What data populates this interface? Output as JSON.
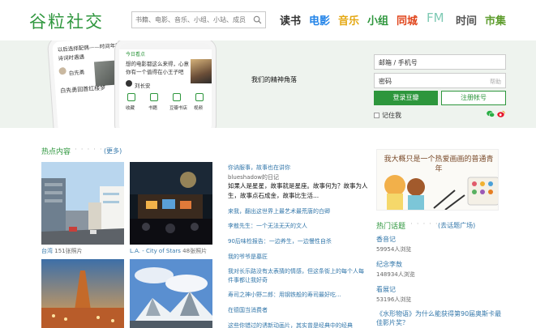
{
  "logo": "谷粒社交",
  "search": {
    "placeholder": "书籍、电影、音乐、小组、小站、成员"
  },
  "nav": [
    {
      "label": "读书",
      "color": "#333333"
    },
    {
      "label": "电影",
      "color": "#2384e8"
    },
    {
      "label": "音乐",
      "color": "#e4a813"
    },
    {
      "label": "小组",
      "color": "#2e963d"
    },
    {
      "label": "同城",
      "color": "#e0451c"
    },
    {
      "label": "FM",
      "color": "#7ecab4"
    },
    {
      "label": "时间",
      "color": "#555555"
    },
    {
      "label": "市集",
      "color": "#5e9d2e"
    }
  ],
  "hero": {
    "slogan": "我们的精神角落",
    "phone1": {
      "line1": "以后选择配偶——时间年轻",
      "line2": "诗词时遇遇",
      "author": "白先勇",
      "title": "白先勇回首红楼梦"
    },
    "phone2": {
      "tag": "今日看点",
      "line1": "想的电影都这么来得，心意",
      "line2": "你有一个值得在小王子吧",
      "author": "刘长安",
      "menu": [
        "收藏",
        "书籍",
        "豆瓣书店",
        "视频"
      ]
    }
  },
  "login": {
    "email_placeholder": "邮箱 / 手机号",
    "password_placeholder": "密码",
    "forgot": "帮助",
    "login_button": "登录豆瓣",
    "register_button": "注册帐号",
    "remember": "记住我"
  },
  "hot": {
    "title": "热点内容",
    "dots": "· · · · · ·",
    "more": "(更多)",
    "photos": [
      {
        "name": "台湾",
        "count": "151张照片"
      },
      {
        "name": "L.A. - City of Stars",
        "count": "48张照片"
      },
      {
        "name": "",
        "count": ""
      },
      {
        "name": "",
        "count": ""
      }
    ]
  },
  "articles": {
    "featured_title": "你讷服事，故事也在讲你",
    "featured_author": "blueshadow的日记",
    "featured_desc": "如果人是星星，故事就是星座。故事何为？故事为人生，故事点石成金，故事比生活...",
    "items": [
      "来我，翻出这世界上最艺术最荒唐的白卿",
      "李敖先生：一个无法无天的文人",
      "90后味检报告：一边养生，一边慢性自杀",
      "我的爷爷是墓匠",
      "我对长乐路没有太表猜的情感，但这条街上的每个人每件事都让我好奇",
      "寿司之神小野二郎：用钢铁般的寿司最好吃...",
      "在德国当消费者",
      "这些你错过的诱新动画片，其实曾是经典中的经典"
    ]
  },
  "sidebar": {
    "banner_text": "我大概只是一个热爱画画的普通青年",
    "topics_title": "热门话题",
    "topics_dots": "· · · · · ·",
    "topics_more": "(去话题广场)",
    "topics": [
      {
        "title": "香音记",
        "count": "59954人浏览"
      },
      {
        "title": "纪念李敖",
        "count": "148934人浏览"
      },
      {
        "title": "看展记",
        "count": "53196人浏览"
      },
      {
        "title": "《水形物语》为什么能获得第90届奥斯卡最佳影片奖？",
        "count": ""
      }
    ]
  }
}
